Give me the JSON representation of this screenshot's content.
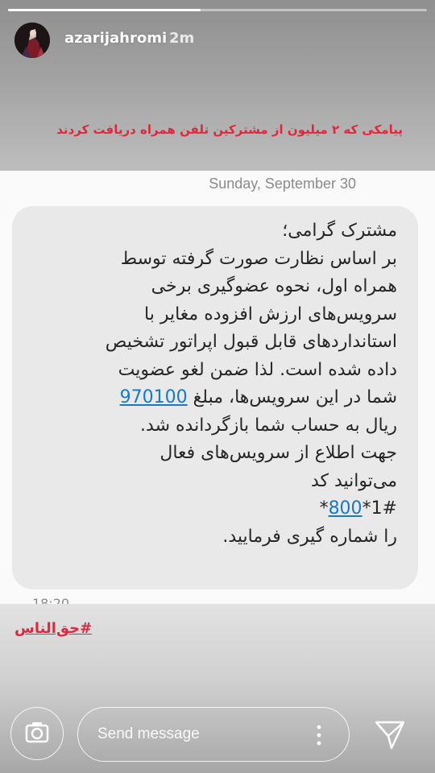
{
  "story": {
    "progress": 0.46,
    "username": "azarijahromi",
    "time_ago": "2m",
    "caption": "پیامکی که ۲ میلیون از مشترکین تلفن همراه دریافت کردند",
    "hashtag": "#حق‌الناس",
    "avatar_icon": "avatar-photo"
  },
  "sms": {
    "date": "Sunday, September 30",
    "lines": [
      "مشترک گرامی؛",
      "بر اساس نظارت صورت گرفته توسط",
      "همراه اول، نحوه عضوگیری برخی",
      "سرویس‌های ارزش افزوده مغایر با",
      "استانداردهای قابل قبول اپراتور تشخیص",
      "داده شده است. لذا ضمن لغو عضویت"
    ],
    "line_amount_pre": "شما در این سرویس‌ها، مبلغ",
    "amount": "970100",
    "lines_after": [
      "ریال به حساب شما بازگردانده شد.",
      "جهت اطلاع از سرویس‌های فعال",
      "می‌توانید کد"
    ],
    "code_star": "*",
    "code_number": "800",
    "code_rest": "*1#",
    "last_line": "را شماره گیری فرمایید.",
    "next_time_partial": "18:20"
  },
  "bottom_bar": {
    "send_placeholder": "Send message",
    "icons": [
      "camera-icon",
      "more-vertical-icon",
      "direct-message-icon"
    ]
  },
  "colors": {
    "caption": "#e3263d",
    "link": "#1779c9",
    "bubble": "#e9e9e9"
  }
}
